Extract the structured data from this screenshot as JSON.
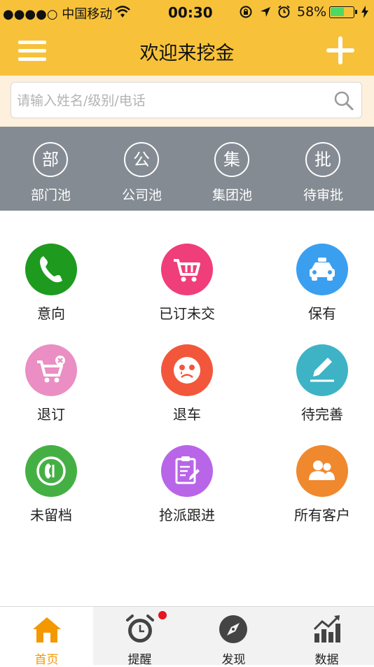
{
  "status_bar": {
    "carrier": "●●●●○ 中国移动",
    "time": "00:30",
    "battery": "58%"
  },
  "header": {
    "title": "欢迎来挖金",
    "menu_icon": "hamburger-icon",
    "add_icon": "plus-icon"
  },
  "search": {
    "placeholder": "请输入姓名/级别/电话",
    "value": ""
  },
  "pools": [
    {
      "glyph": "部",
      "label": "部门池"
    },
    {
      "glyph": "公",
      "label": "公司池"
    },
    {
      "glyph": "集",
      "label": "集团池"
    },
    {
      "glyph": "批",
      "label": "待审批"
    }
  ],
  "grid": [
    {
      "label": "意向",
      "icon": "phone-icon",
      "color": "#1e9a1e"
    },
    {
      "label": "已订未交",
      "icon": "cart-icon",
      "color": "#ef3e7a"
    },
    {
      "label": "保有",
      "icon": "car-icon",
      "color": "#3b9ff0"
    },
    {
      "label": "退订",
      "icon": "cart-cancel-icon",
      "color": "#ea8ec3"
    },
    {
      "label": "退车",
      "icon": "sad-face-icon",
      "color": "#f2573b"
    },
    {
      "label": "待完善",
      "icon": "pencil-icon",
      "color": "#3eb3c6"
    },
    {
      "label": "未留档",
      "icon": "no-record-phone-icon",
      "color": "#44b044"
    },
    {
      "label": "抢派跟进",
      "icon": "clipboard-edit-icon",
      "color": "#b865e8"
    },
    {
      "label": "所有客户",
      "icon": "users-icon",
      "color": "#f0882e"
    }
  ],
  "tabs": [
    {
      "label": "首页",
      "icon": "home-icon",
      "active": true
    },
    {
      "label": "提醒",
      "icon": "alarm-clock-icon",
      "badge_dot": true
    },
    {
      "label": "发现",
      "icon": "compass-icon"
    },
    {
      "label": "数据",
      "icon": "chart-icon"
    }
  ],
  "colors": {
    "brand": "#f7c23a",
    "active_tab": "#f39800",
    "pool_bg": "#848b93",
    "badge": "#e8141e"
  }
}
